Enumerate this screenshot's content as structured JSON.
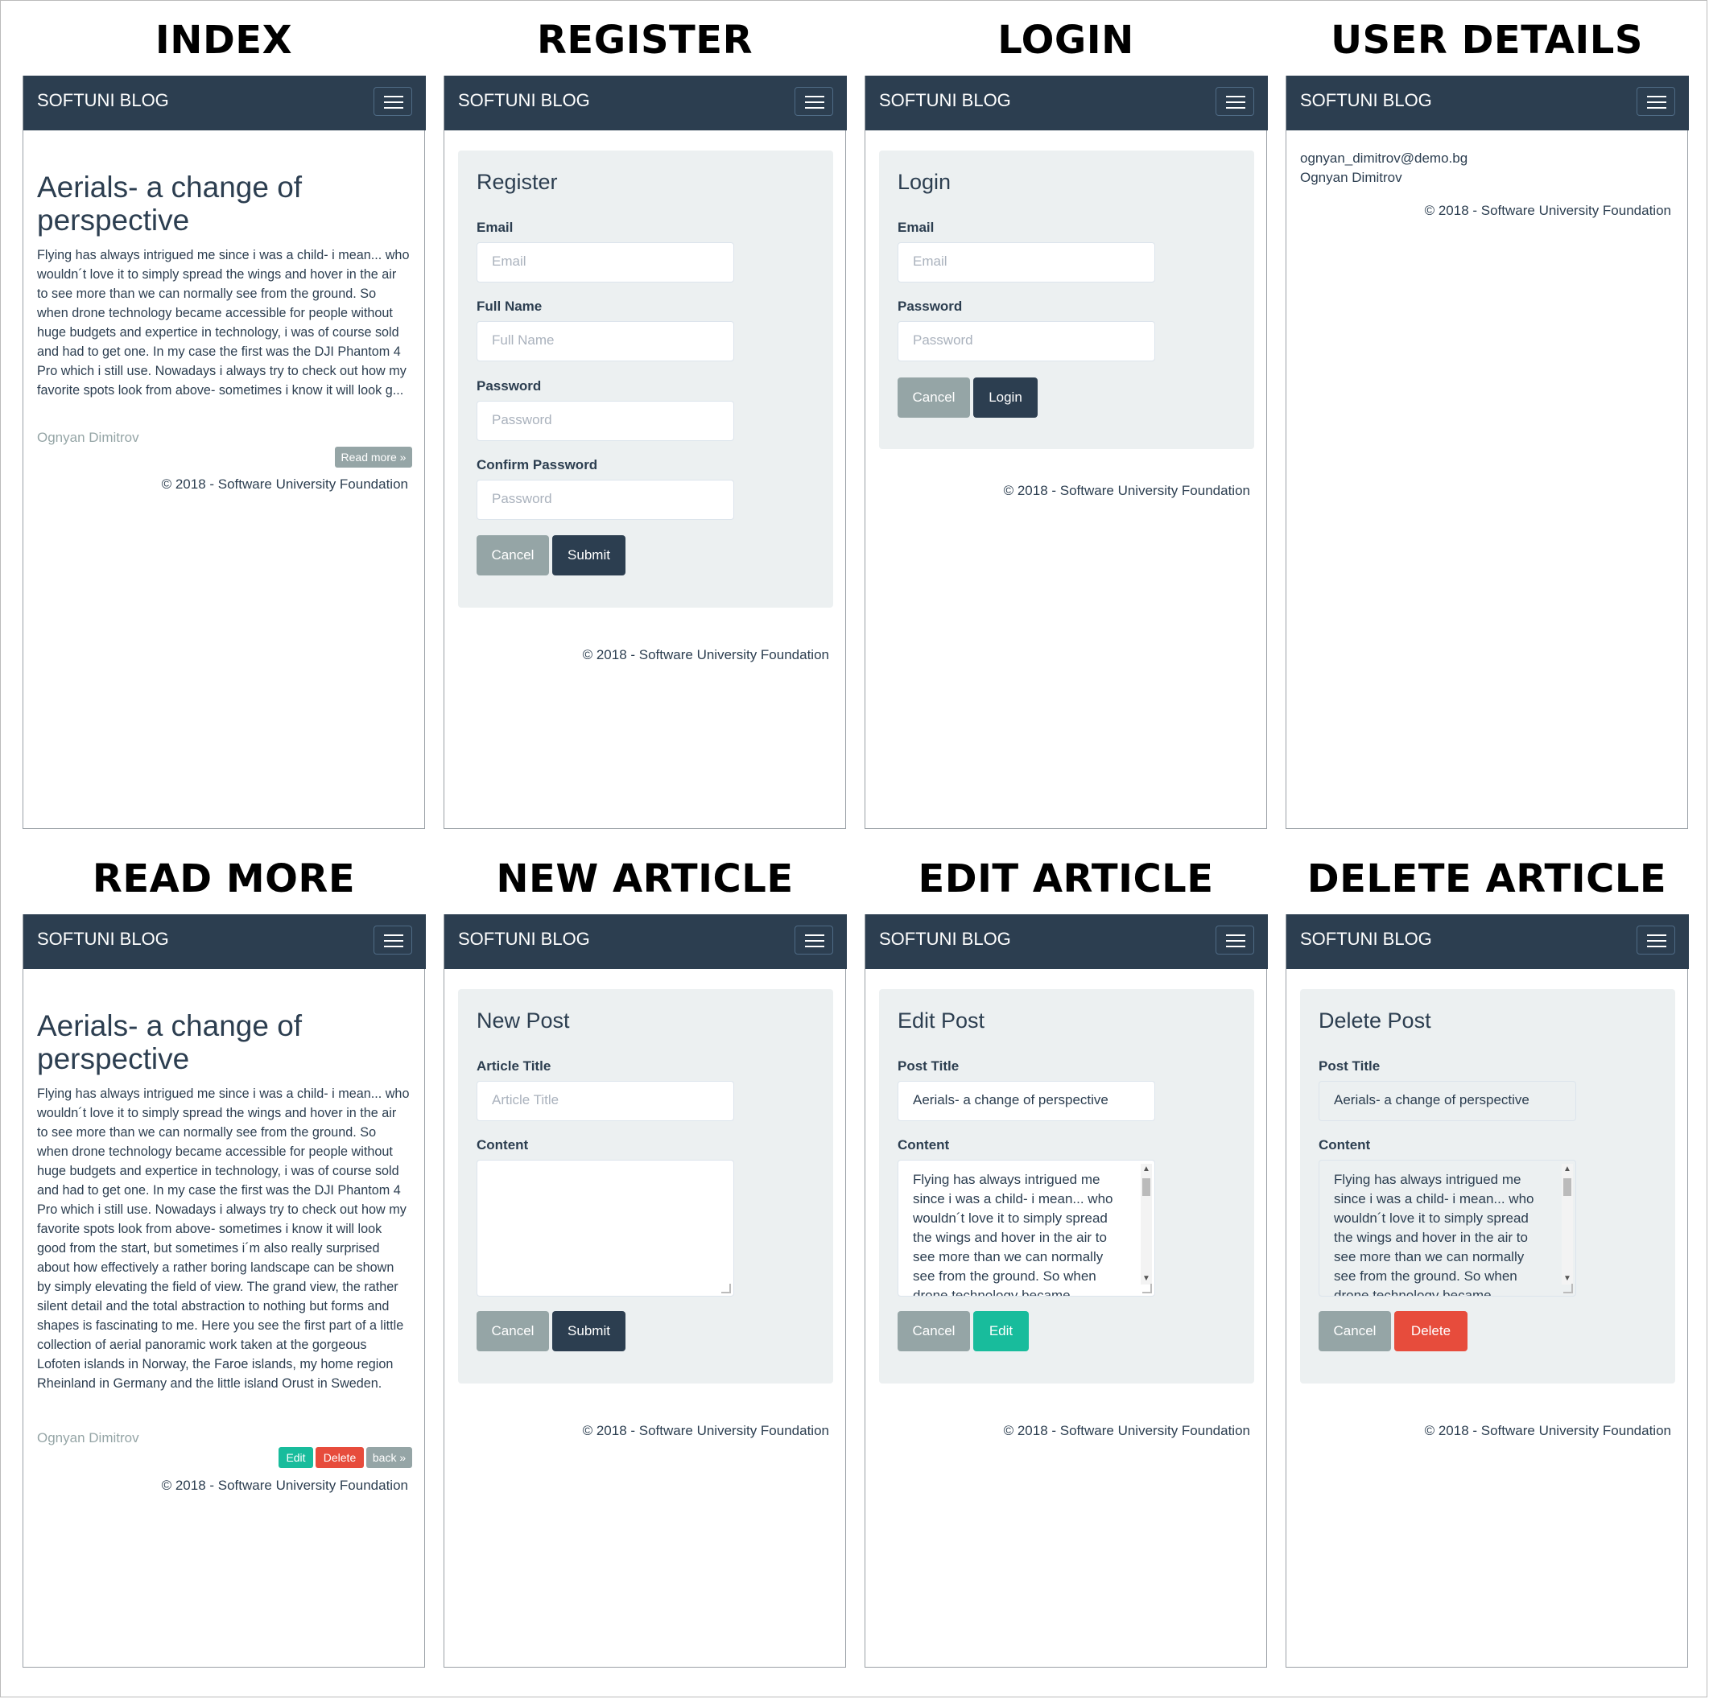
{
  "brand": "SOFTUNI BLOG",
  "footer": "© 2018 - Software University Foundation",
  "panels": {
    "index": {
      "title": "INDEX",
      "article_title": "Aerials- a change of perspective",
      "excerpt": "Flying has always intrigued me since i was a child- i mean... who wouldn´t love it to simply spread the wings and hover in the air to see more than we can normally see from the ground. So when drone technology became accessible for people without huge budgets and expertice in technology, i was of course sold and had to get one. In my case the first was the DJI Phantom 4 Pro which i still use. Nowadays i always try to check out how my favorite spots look from above- sometimes i know it will look g...",
      "author": "Ognyan Dimitrov",
      "read_more": "Read more »"
    },
    "register": {
      "title": "REGISTER",
      "legend": "Register",
      "email_label": "Email",
      "email_placeholder": "Email",
      "fullname_label": "Full Name",
      "fullname_placeholder": "Full Name",
      "password_label": "Password",
      "password_placeholder": "Password",
      "confirm_label": "Confirm Password",
      "confirm_placeholder": "Password",
      "cancel": "Cancel",
      "submit": "Submit"
    },
    "login": {
      "title": "LOGIN",
      "legend": "Login",
      "email_label": "Email",
      "email_placeholder": "Email",
      "password_label": "Password",
      "password_placeholder": "Password",
      "cancel": "Cancel",
      "login": "Login"
    },
    "user_details": {
      "title": "USER DETAILS",
      "email": "ognyan_dimitrov@demo.bg",
      "name": "Ognyan Dimitrov"
    },
    "read_more": {
      "title": "READ MORE",
      "article_title": "Aerials- a change of perspective",
      "body": "Flying has always intrigued me since i was a child- i mean... who wouldn´t love it to simply spread the wings and hover in the air to see more than we can normally see from the ground. So when drone technology became accessible for people without huge budgets and expertice in technology, i was of course sold and had to get one. In my case the first was the DJI Phantom 4 Pro which i still use. Nowadays i always try to check out how my favorite spots look from above- sometimes i know it will look good from the start, but sometimes i´m also really surprised about how effectively a rather boring landscape can be shown by simply elevating the field of view. The grand view, the rather silent detail and the total abstraction to nothing but forms and shapes is fascinating to me. Here you see the first part of a little collection of aerial panoramic work taken at the gorgeous Lofoten islands in Norway, the Faroe islands, my home region Rheinland in Germany and the little island Orust in Sweden.",
      "author": "Ognyan Dimitrov",
      "edit": "Edit",
      "delete": "Delete",
      "back": "back »"
    },
    "new_article": {
      "title": "NEW ARTICLE",
      "legend": "New Post",
      "title_label": "Article Title",
      "title_placeholder": "Article Title",
      "content_label": "Content",
      "cancel": "Cancel",
      "submit": "Submit"
    },
    "edit_article": {
      "title": "EDIT ARTICLE",
      "legend": "Edit Post",
      "title_label": "Post Title",
      "title_value": "Aerials- a change of perspective",
      "content_label": "Content",
      "content_value": "Flying has always intrigued me since i was a child- i mean... who wouldn´t love it to simply spread the wings and hover in the air to see more than we can normally see from the ground. So when drone technology became accessible for",
      "cancel": "Cancel",
      "edit": "Edit"
    },
    "delete_article": {
      "title": "DELETE ARTICLE",
      "legend": "Delete Post",
      "title_label": "Post Title",
      "title_value": "Aerials- a change of perspective",
      "content_label": "Content",
      "content_value": "Flying has always intrigued me since i was a child- i mean... who wouldn´t love it to simply spread the wings and hover in the air to see more than we can normally see from the ground. So when drone technology became accessible for",
      "cancel": "Cancel",
      "delete": "Delete"
    }
  },
  "colors": {
    "navbar": "#2c3e50",
    "well": "#ecf0f1",
    "btn_grey": "#95a5a6",
    "btn_teal": "#18bc9c",
    "btn_red": "#e74c3c"
  }
}
